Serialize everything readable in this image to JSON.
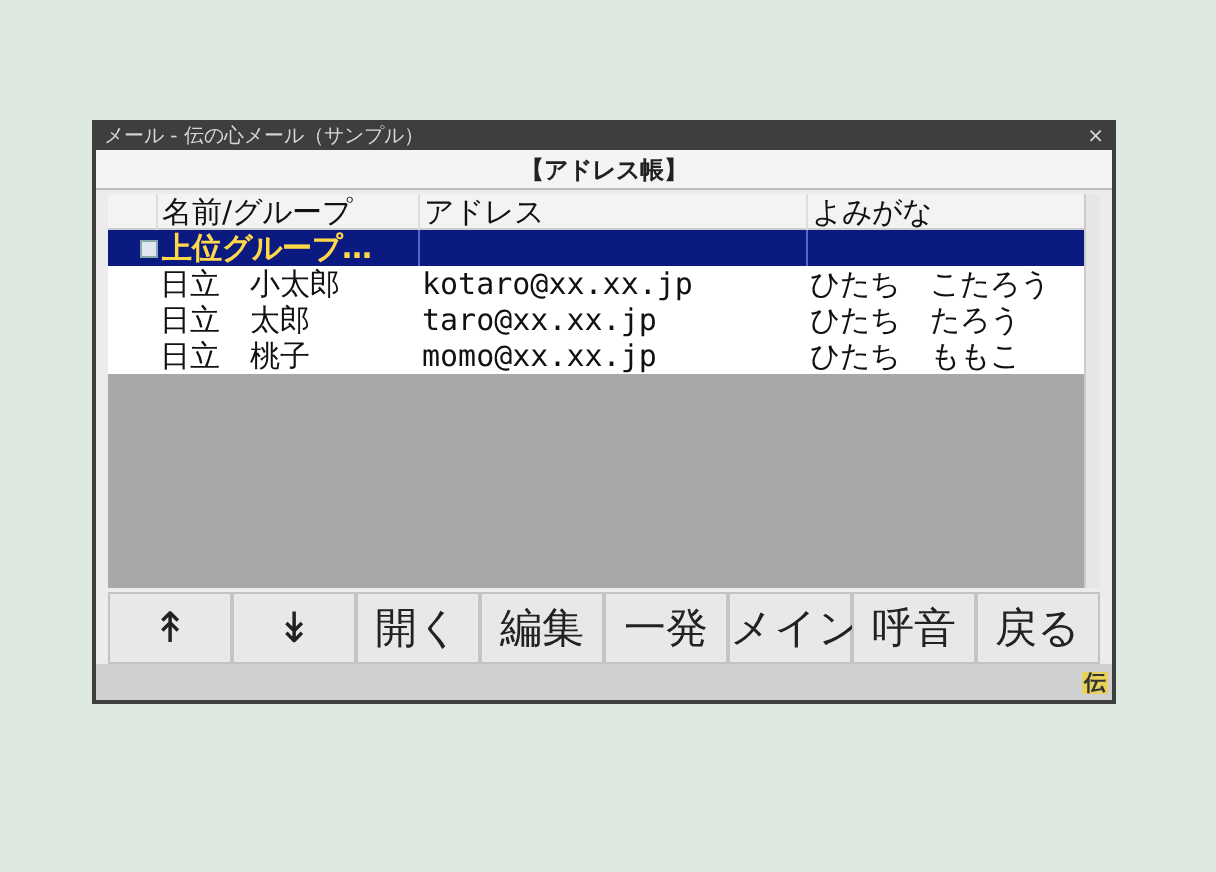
{
  "window": {
    "title": "メール - 伝の心メール（サンプル）",
    "close": "×"
  },
  "header": "【アドレス帳】",
  "table": {
    "columns": [
      "名前/グループ",
      "アドレス",
      "よみがな"
    ],
    "rows": [
      {
        "kind": "group",
        "selected": true,
        "cells": [
          "上位グループ…",
          "",
          ""
        ]
      },
      {
        "kind": "contact",
        "selected": false,
        "cells": [
          "日立　小太郎",
          "kotaro@xx.xx.jp",
          "ひたち　こたろう"
        ]
      },
      {
        "kind": "contact",
        "selected": false,
        "cells": [
          "日立　太郎",
          "taro@xx.xx.jp",
          "ひたち　たろう"
        ]
      },
      {
        "kind": "contact",
        "selected": false,
        "cells": [
          "日立　桃子",
          "momo@xx.xx.jp",
          "ひたち　ももこ"
        ]
      }
    ]
  },
  "buttons": [
    "↟",
    "↡",
    "開く",
    "編集",
    "一発",
    "メイン",
    "呼音",
    "戻る"
  ],
  "status_bar": {
    "badge": "伝"
  }
}
